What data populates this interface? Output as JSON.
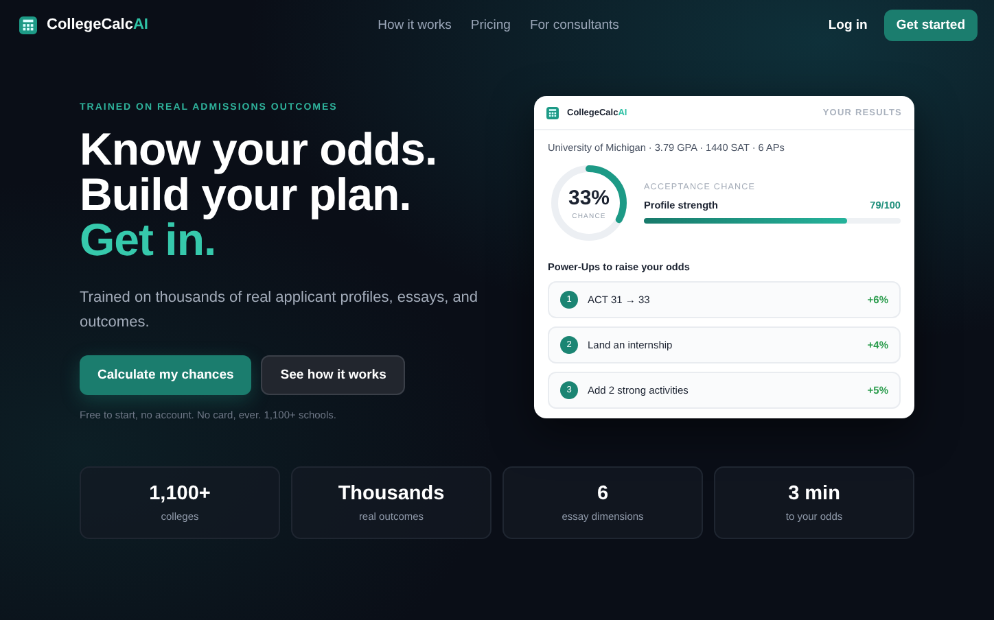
{
  "nav": {
    "logo": {
      "name": "CollegeCalc",
      "accent": "AI"
    },
    "links": [
      "How it works",
      "Pricing",
      "For consultants"
    ],
    "login": "Log in",
    "cta": "Get started"
  },
  "hero": {
    "eyebrow": "TRAINED ON REAL ADMISSIONS OUTCOMES",
    "headline": [
      "Know your odds.",
      "Build your plan."
    ],
    "highlight": "Get in.",
    "subtitle": "Trained on thousands of real applicant profiles, essays, and outcomes.",
    "buttons": [
      {
        "label": "Calculate my chances",
        "kind": "primary"
      },
      {
        "label": "See how it works",
        "kind": "secondary"
      }
    ],
    "note": "Free to start, no account. No card, ever. 1,100+ schools."
  },
  "results_card": {
    "logo": {
      "name": "CollegeCalc",
      "accent": "AI"
    },
    "header_label": "YOUR RESULTS",
    "profile": "University of Michigan · 3.79 GPA · 1440 SAT · 6 APs",
    "chance": {
      "value": "33%",
      "label": "CHANCE",
      "level": 0.33
    },
    "acceptance_label": "ACCEPTANCE CHANCE",
    "strength": {
      "label": "Profile strength",
      "reading": "79/100",
      "level": 0.79
    },
    "powerups_title": "Power-Ups to raise your odds",
    "powerups": [
      {
        "number": "1",
        "text": "ACT 31 → 33",
        "gain": "+6%"
      },
      {
        "number": "2",
        "text": "Land an internship",
        "gain": "+4%"
      },
      {
        "number": "3",
        "text": "Add 2 strong activities",
        "gain": "+5%"
      }
    ]
  },
  "stats": [
    {
      "value": "1,100+",
      "label": "colleges"
    },
    {
      "value": "Thousands",
      "label": "real outcomes"
    },
    {
      "value": "6",
      "label": "essay dimensions"
    },
    {
      "value": "3 min",
      "label": "to your odds"
    }
  ]
}
